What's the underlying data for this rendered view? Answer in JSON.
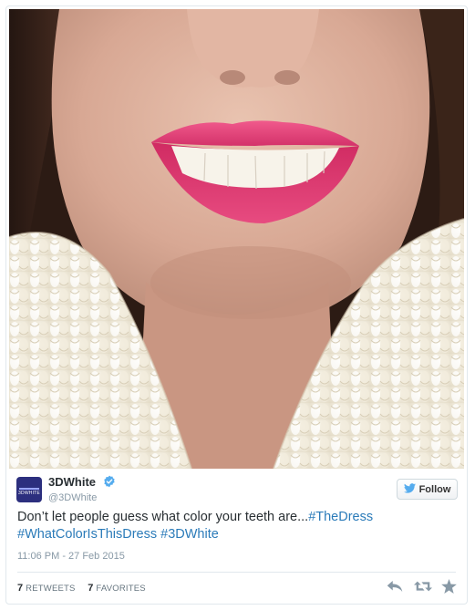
{
  "tweet": {
    "display_name": "3DWhite",
    "handle": "@3DWhite",
    "avatar_text": "3DWHITE",
    "verified": true,
    "follow_label": "Follow",
    "text_plain": "Don’t let people guess what color your teeth are...",
    "hashtag_1": "#TheDress",
    "hashtag_2": "#WhatColorIsThisDress",
    "hashtag_3": "#3DWhite",
    "timestamp": "11:06 PM - 27 Feb 2015",
    "retweets_count": "7",
    "retweets_label": "RETWEETS",
    "favorites_count": "7",
    "favorites_label": "FAVORITES"
  },
  "icons": {
    "verified": "verified-badge-icon",
    "follow_bird": "twitter-bird-icon",
    "reply": "reply-icon",
    "retweet": "retweet-icon",
    "favorite": "star-icon"
  },
  "colors": {
    "link": "#2b7bb9",
    "verified": "#55acee",
    "bird": "#55acee",
    "avatar_bg": "#2c2f7e",
    "action_icons": "#8899a6"
  }
}
